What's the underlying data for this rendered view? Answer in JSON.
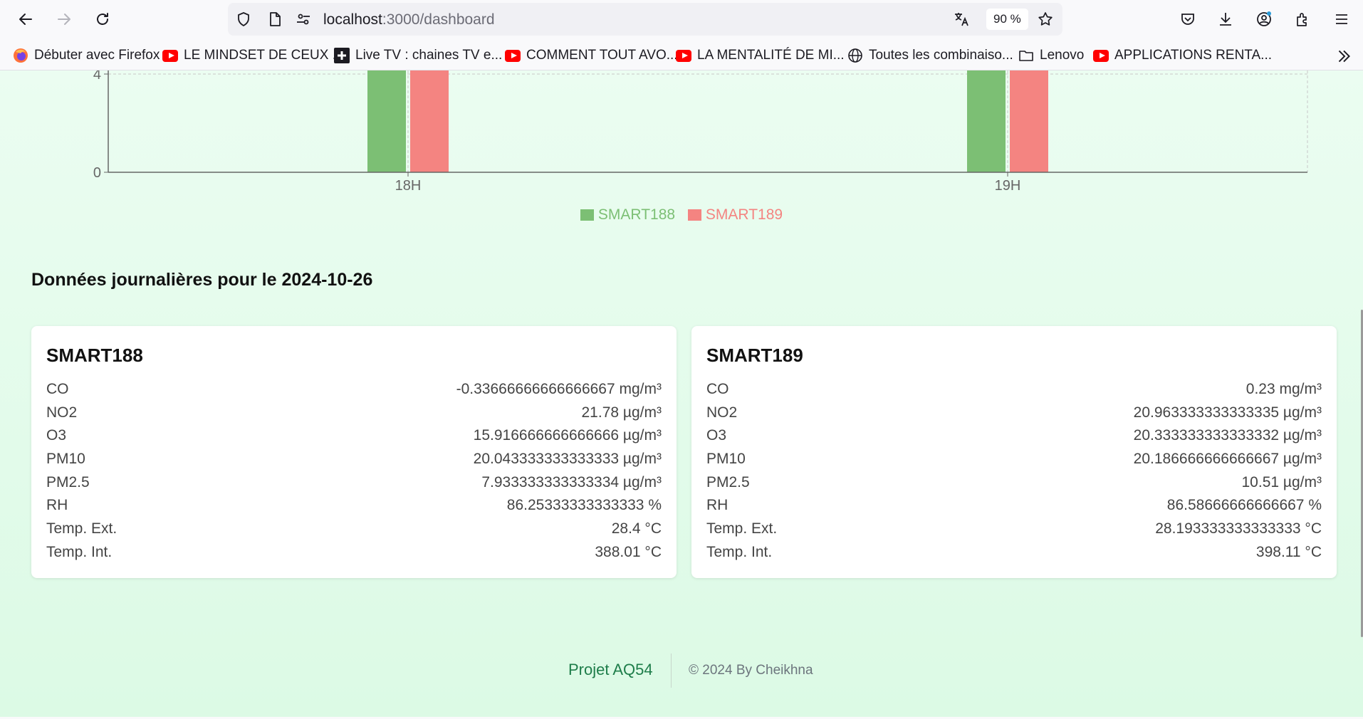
{
  "browser": {
    "url_host": "localhost",
    "url_path": ":3000/dashboard",
    "zoom": "90 %",
    "bookmarks": [
      {
        "label": "Débuter avec Firefox",
        "icon": "firefox-icon"
      },
      {
        "label": "LE MINDSET DE CEUX ...",
        "icon": "youtube-icon"
      },
      {
        "label": "Live TV : chaines TV e...",
        "icon": "plus-icon"
      },
      {
        "label": "COMMENT TOUT AVO...",
        "icon": "youtube-icon"
      },
      {
        "label": "LA MENTALITÉ DE MI...",
        "icon": "youtube-icon"
      },
      {
        "label": "Toutes les combinaiso...",
        "icon": "globe-icon"
      },
      {
        "label": "Lenovo",
        "icon": "folder-icon"
      },
      {
        "label": "APPLICATIONS RENTA...",
        "icon": "youtube-icon"
      }
    ]
  },
  "chart_data": {
    "type": "bar",
    "categories": [
      "18H",
      "19H"
    ],
    "series": [
      {
        "name": "SMART188",
        "values": [
          5,
          5
        ],
        "color": "#7cbf74"
      },
      {
        "name": "SMART189",
        "values": [
          5,
          5
        ],
        "color": "#f48481"
      }
    ],
    "yticks": [
      0,
      4
    ],
    "grid": true,
    "legend": "bottom-center"
  },
  "daily": {
    "title": "Données journalières pour le 2024-10-26",
    "stations": [
      {
        "name": "SMART188",
        "rows": [
          {
            "label": "CO",
            "value": "-0.33666666666666667 mg/m³"
          },
          {
            "label": "NO2",
            "value": "21.78 µg/m³"
          },
          {
            "label": "O3",
            "value": "15.916666666666666 µg/m³"
          },
          {
            "label": "PM10",
            "value": "20.043333333333333 µg/m³"
          },
          {
            "label": "PM2.5",
            "value": "7.933333333333334 µg/m³"
          },
          {
            "label": "RH",
            "value": "86.25333333333333 %"
          },
          {
            "label": "Temp. Ext.",
            "value": "28.4 °C"
          },
          {
            "label": "Temp. Int.",
            "value": "388.01 °C"
          }
        ]
      },
      {
        "name": "SMART189",
        "rows": [
          {
            "label": "CO",
            "value": "0.23 mg/m³"
          },
          {
            "label": "NO2",
            "value": "20.963333333333335 µg/m³"
          },
          {
            "label": "O3",
            "value": "20.333333333333332 µg/m³"
          },
          {
            "label": "PM10",
            "value": "20.186666666666667 µg/m³"
          },
          {
            "label": "PM2.5",
            "value": "10.51 µg/m³"
          },
          {
            "label": "RH",
            "value": "86.58666666666667 %"
          },
          {
            "label": "Temp. Ext.",
            "value": "28.193333333333333 °C"
          },
          {
            "label": "Temp. Int.",
            "value": "398.11 °C"
          }
        ]
      }
    ]
  },
  "footer": {
    "brand": "Projet AQ54",
    "copyright": "© 2024 By Cheikhna"
  }
}
